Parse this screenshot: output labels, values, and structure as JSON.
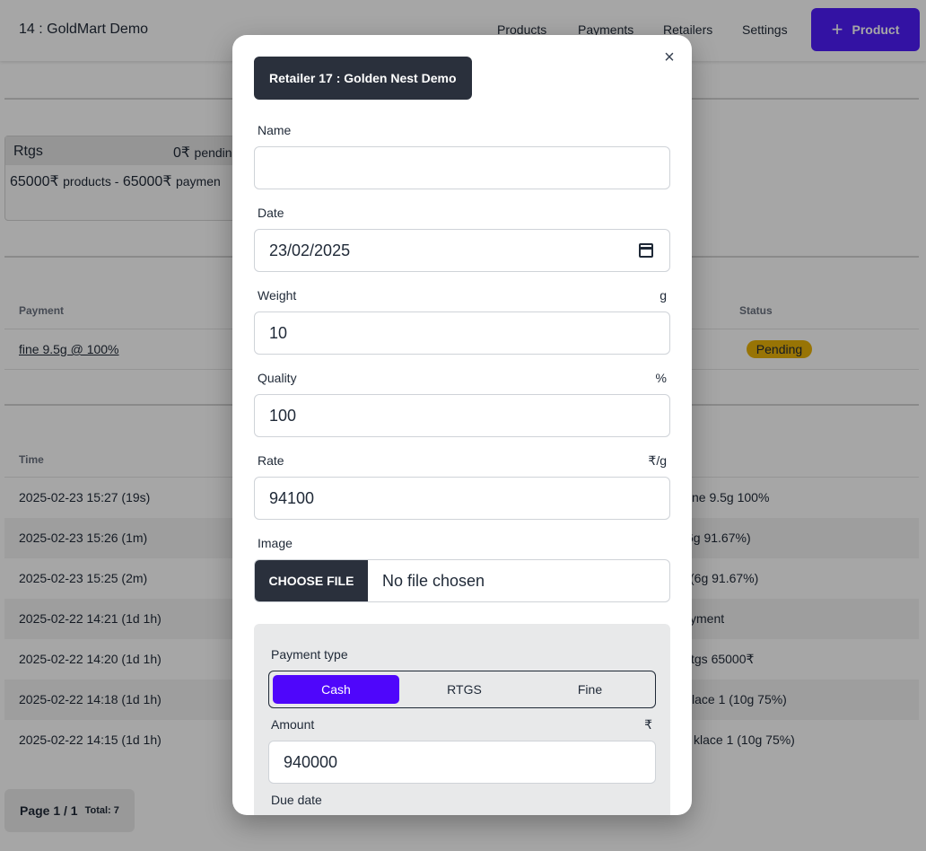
{
  "header": {
    "brand": "14 : GoldMart Demo",
    "nav": [
      "Products",
      "Payments",
      "Retailers",
      "Settings"
    ],
    "add_button_label": "Product"
  },
  "summary": {
    "title": "Rtgs",
    "pending_amount": "0₹",
    "pending_label": "pendin",
    "products_amount": "65000₹",
    "products_label": "products -",
    "payments_amount": "65000₹",
    "payments_label": "paymen"
  },
  "payments_table": {
    "headers": [
      "Payment",
      "Status"
    ],
    "row": {
      "payment": "fine 9.5g @ 100%",
      "status": "Pending"
    }
  },
  "activity_table": {
    "header_time": "Time",
    "rows": [
      {
        "time": "2025-02-23 15:27 (19s)",
        "desc": "ne 9.5g 100%"
      },
      {
        "time": "2025-02-23 15:26 (1m)",
        "desc": "6g 91.67%)"
      },
      {
        "time": "2025-02-23 15:25 (2m)",
        "desc": "(6g 91.67%)"
      },
      {
        "time": "2025-02-22 14:21 (1d 1h)",
        "desc": "yment"
      },
      {
        "time": "2025-02-22 14:20 (1d 1h)",
        "desc": "tgs 65000₹"
      },
      {
        "time": "2025-02-22 14:18 (1d 1h)",
        "desc": "lace 1 (10g 75%)"
      },
      {
        "time": "2025-02-22 14:15 (1d 1h)",
        "desc": "klace 1 (10g 75%)"
      }
    ]
  },
  "pagination": {
    "page": "Page 1 / 1",
    "total": "Total: 7"
  },
  "modal": {
    "badge": "Retailer 17 : Golden Nest Demo",
    "close_symbol": "×",
    "fields": {
      "name": {
        "label": "Name",
        "value": ""
      },
      "date": {
        "label": "Date",
        "value": "23/02/2025"
      },
      "weight": {
        "label": "Weight",
        "unit": "g",
        "value": "10"
      },
      "quality": {
        "label": "Quality",
        "unit": "%",
        "value": "100"
      },
      "rate": {
        "label": "Rate",
        "unit": "₹/g",
        "value": "94100"
      },
      "image": {
        "label": "Image",
        "button": "CHOOSE FILE",
        "status": "No file chosen"
      }
    },
    "payment": {
      "type_label": "Payment type",
      "options": [
        "Cash",
        "RTGS",
        "Fine"
      ],
      "selected": "Cash",
      "amount_label": "Amount",
      "amount_unit": "₹",
      "amount_value": "940000",
      "due_date_label": "Due date"
    }
  },
  "colors": {
    "accent": "#4f06fb",
    "dark_button": "#2a303c",
    "pending_badge": "#eab308"
  }
}
